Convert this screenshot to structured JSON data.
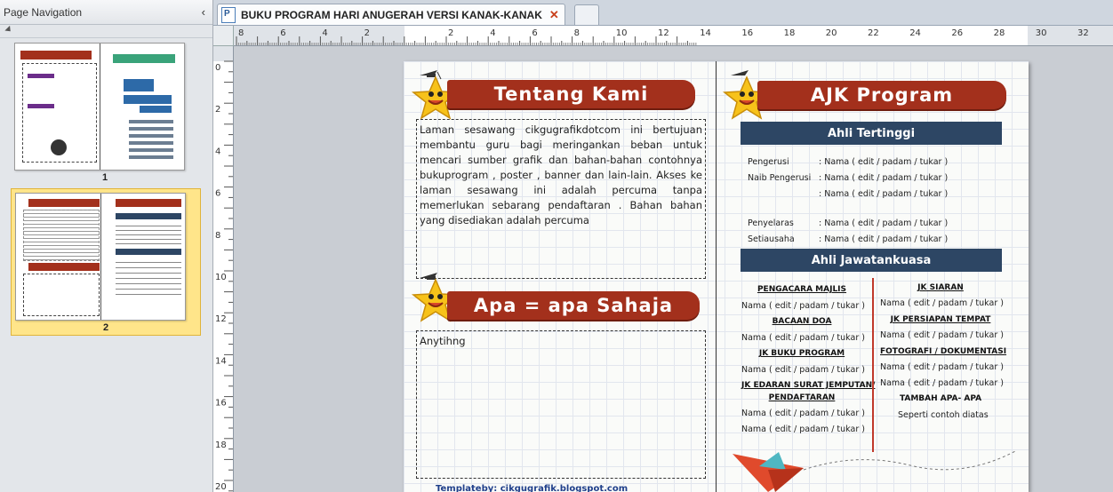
{
  "nav": {
    "title": "Page Navigation",
    "collapse_glyph": "‹",
    "thumbnails": [
      {
        "number": "1"
      },
      {
        "number": "2"
      }
    ]
  },
  "tab": {
    "title": "BUKU PROGRAM HARI ANUGERAH VERSI KANAK-KANAK",
    "close_glyph": "✕"
  },
  "ruler": {
    "h_labels": [
      "8",
      "6",
      "4",
      "2",
      "",
      "2",
      "4",
      "6",
      "8",
      "10",
      "12",
      "14",
      "16",
      "18",
      "20",
      "22",
      "24",
      "26",
      "28",
      "30",
      "32"
    ],
    "v_labels": [
      "0",
      "2",
      "4",
      "6",
      "8",
      "10",
      "12",
      "14",
      "16",
      "18",
      "20"
    ]
  },
  "left_page": {
    "about": {
      "heading": "Tentang Kami",
      "body": "Laman sesawang cikgugrafikdotcom ini bertujuan membantu guru bagi meringankan beban untuk mencari sumber grafik dan bahan-bahan contohnya bukuprogram , poster , banner dan lain-lain. Akses ke laman sesawang ini adalah percuma tanpa memerlukan sebarang pendaftaran . Bahan bahan yang disediakan adalah percuma"
    },
    "misc": {
      "heading": "Apa = apa Sahaja",
      "body": "Anytihng"
    },
    "footer": "Templateby: cikgugrafik.blogspot.com"
  },
  "right_page": {
    "heading": "AJK Program",
    "top_committee": {
      "title": "Ahli Tertinggi",
      "rows": [
        {
          "label": "Pengerusi",
          "value": ": Nama  ( edit / padam / tukar )"
        },
        {
          "label": "Naib Pengerusi",
          "value": ": Nama  ( edit / padam / tukar )"
        },
        {
          "label": "",
          "value": ": Nama  ( edit / padam / tukar )"
        },
        {
          "label": "Penyelaras",
          "value": ": Nama  ( edit / padam / tukar )"
        },
        {
          "label": "Setiausaha",
          "value": ": Nama  ( edit / padam / tukar )"
        }
      ]
    },
    "working_committee": {
      "title": "Ahli Jawatankuasa",
      "left_col": [
        {
          "head": "PENGACARA MAJLIS",
          "names": [
            "Nama  ( edit / padam / tukar )"
          ]
        },
        {
          "head": "BACAAN DOA",
          "names": [
            "Nama  ( edit / padam / tukar )"
          ]
        },
        {
          "head": "JK BUKU PROGRAM",
          "names": [
            "Nama  ( edit / padam / tukar )"
          ]
        },
        {
          "head": "JK EDARAN SURAT JEMPUTAN/",
          "head2": "PENDAFTARAN",
          "names": [
            "Nama  ( edit / padam / tukar )",
            "Nama  ( edit / padam / tukar )"
          ]
        }
      ],
      "right_col": [
        {
          "head": "JK SIARAN",
          "names": [
            "Nama  ( edit / padam / tukar )"
          ]
        },
        {
          "head": "JK PERSIAPAN TEMPAT",
          "names": [
            "Nama  ( edit / padam / tukar )"
          ]
        },
        {
          "head": "FOTOGRAFI / DOKUMENTASI",
          "names": [
            "Nama  ( edit / padam / tukar )",
            "Nama  ( edit / padam / tukar )"
          ]
        },
        {
          "head": "TAMBAH APA- APA",
          "names": [
            "Seperti contoh diatas"
          ]
        }
      ]
    }
  },
  "colors": {
    "banner_red": "#a3301c",
    "navy": "#2d4664",
    "star_yellow": "#f7c21a",
    "selection_yellow": "#ffe58a"
  }
}
